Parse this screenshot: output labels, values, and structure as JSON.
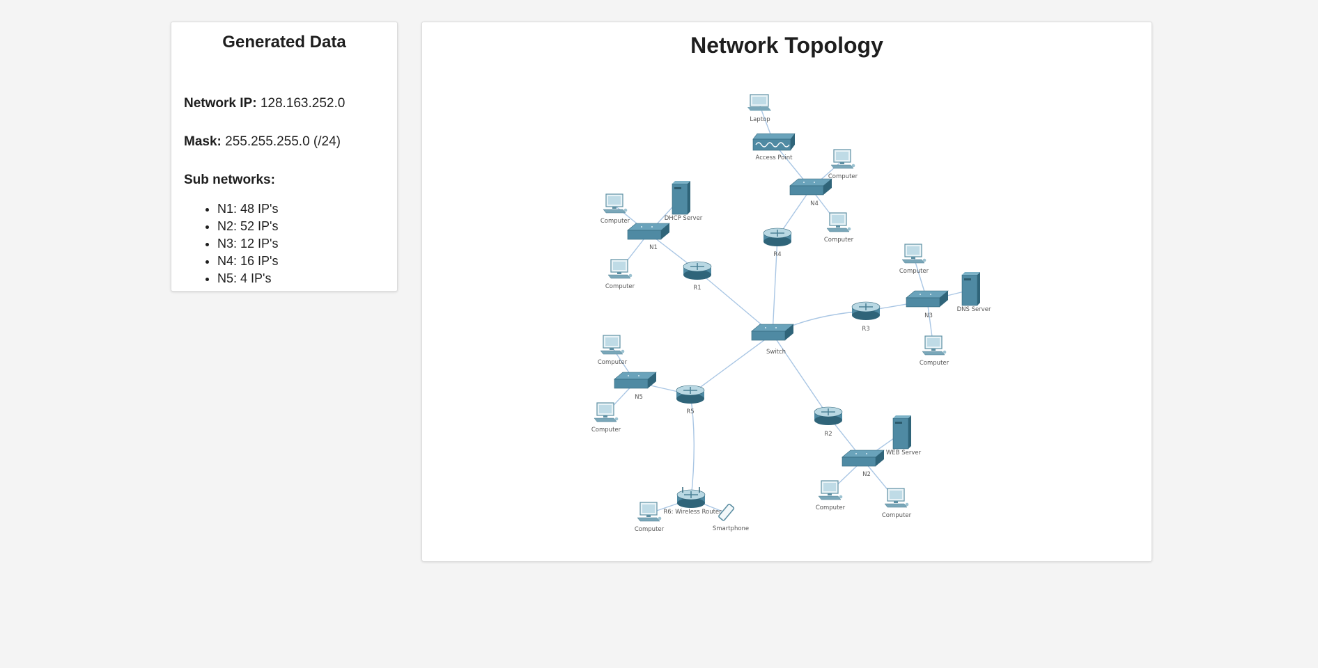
{
  "generated": {
    "title": "Generated Data",
    "network_ip_label": "Network IP:",
    "network_ip": "128.163.252.0",
    "mask_label": "Mask:",
    "mask": "255.255.255.0 (/24)",
    "subnets_label": "Sub networks:",
    "subnets": [
      {
        "text": "N1: 48 IP's"
      },
      {
        "text": "N2: 52 IP's"
      },
      {
        "text": "N3: 12 IP's"
      },
      {
        "text": "N4: 16 IP's"
      },
      {
        "text": "N5: 4 IP's"
      }
    ]
  },
  "topology": {
    "title": "Network Topology",
    "colors": {
      "device": "#4f8aa3",
      "device_dark": "#2f6479",
      "link": "#a9c6e4"
    },
    "nodes": [
      {
        "id": "switch",
        "type": "switch",
        "label": "Switch"
      },
      {
        "id": "r1",
        "type": "router",
        "label": "R1"
      },
      {
        "id": "r2",
        "type": "router",
        "label": "R2"
      },
      {
        "id": "r3",
        "type": "router",
        "label": "R3"
      },
      {
        "id": "r4",
        "type": "router",
        "label": "R4"
      },
      {
        "id": "r5",
        "type": "router",
        "label": "R5"
      },
      {
        "id": "r6",
        "type": "wireless-router",
        "label": "R6: Wireless Router"
      },
      {
        "id": "n1",
        "type": "switch",
        "label": "N1"
      },
      {
        "id": "n2",
        "type": "switch",
        "label": "N2"
      },
      {
        "id": "n3",
        "type": "switch",
        "label": "N3"
      },
      {
        "id": "n4",
        "type": "switch",
        "label": "N4"
      },
      {
        "id": "n5",
        "type": "switch",
        "label": "N5"
      },
      {
        "id": "dhcp",
        "type": "server",
        "label": "DHCP Server"
      },
      {
        "id": "web",
        "type": "server",
        "label": "WEB Server"
      },
      {
        "id": "dns",
        "type": "server",
        "label": "DNS Server"
      },
      {
        "id": "ap",
        "type": "access-point",
        "label": "Access Point"
      },
      {
        "id": "laptop",
        "type": "laptop",
        "label": "Laptop"
      },
      {
        "id": "phone",
        "type": "smartphone",
        "label": "Smartphone"
      },
      {
        "id": "c_n1a",
        "type": "computer",
        "label": "Computer"
      },
      {
        "id": "c_n1b",
        "type": "computer",
        "label": "Computer"
      },
      {
        "id": "c_n4a",
        "type": "computer",
        "label": "Computer"
      },
      {
        "id": "c_n4b",
        "type": "computer",
        "label": "Computer"
      },
      {
        "id": "c_n3a",
        "type": "computer",
        "label": "Computer"
      },
      {
        "id": "c_n3b",
        "type": "computer",
        "label": "Computer"
      },
      {
        "id": "c_n5a",
        "type": "computer",
        "label": "Computer"
      },
      {
        "id": "c_n5b",
        "type": "computer",
        "label": "Computer"
      },
      {
        "id": "c_n2a",
        "type": "computer",
        "label": "Computer"
      },
      {
        "id": "c_n2b",
        "type": "computer",
        "label": "Computer"
      },
      {
        "id": "c_r6",
        "type": "computer",
        "label": "Computer"
      }
    ],
    "links": [
      [
        "switch",
        "r1"
      ],
      [
        "switch",
        "r2"
      ],
      [
        "switch",
        "r3"
      ],
      [
        "switch",
        "r4"
      ],
      [
        "switch",
        "r5"
      ],
      [
        "r1",
        "n1"
      ],
      [
        "n1",
        "dhcp"
      ],
      [
        "n1",
        "c_n1a"
      ],
      [
        "n1",
        "c_n1b"
      ],
      [
        "r4",
        "n4"
      ],
      [
        "n4",
        "ap"
      ],
      [
        "ap",
        "laptop"
      ],
      [
        "n4",
        "c_n4a"
      ],
      [
        "n4",
        "c_n4b"
      ],
      [
        "r3",
        "n3"
      ],
      [
        "n3",
        "dns"
      ],
      [
        "n3",
        "c_n3a"
      ],
      [
        "n3",
        "c_n3b"
      ],
      [
        "r5",
        "n5"
      ],
      [
        "n5",
        "c_n5a"
      ],
      [
        "n5",
        "c_n5b"
      ],
      [
        "r5",
        "r6"
      ],
      [
        "r6",
        "c_r6"
      ],
      [
        "r6",
        "phone"
      ],
      [
        "r2",
        "n2"
      ],
      [
        "n2",
        "web"
      ],
      [
        "n2",
        "c_n2a"
      ],
      [
        "n2",
        "c_n2b"
      ]
    ]
  }
}
